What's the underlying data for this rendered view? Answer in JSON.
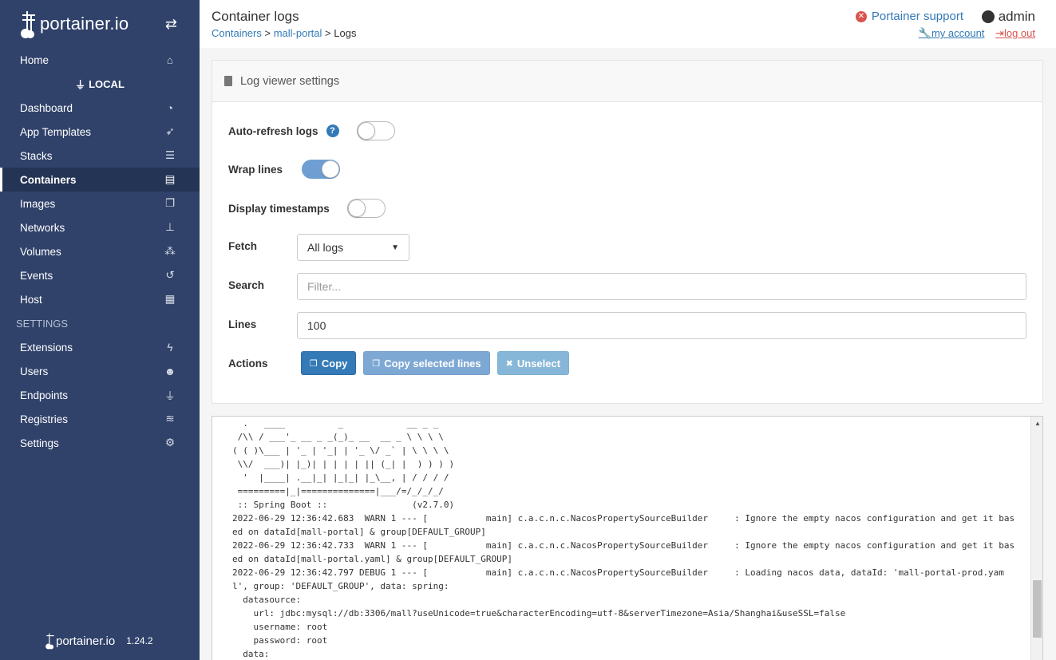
{
  "brand": {
    "name": "portainer.io",
    "version": "1.24.2"
  },
  "sidebar": {
    "items": [
      {
        "label": "Home",
        "icon": "home-icon"
      },
      {
        "label": "LOCAL",
        "icon": "plug-icon"
      },
      {
        "label": "Dashboard",
        "icon": "tachometer-icon"
      },
      {
        "label": "App Templates",
        "icon": "rocket-icon"
      },
      {
        "label": "Stacks",
        "icon": "list-icon"
      },
      {
        "label": "Containers",
        "icon": "server-icon"
      },
      {
        "label": "Images",
        "icon": "clone-icon"
      },
      {
        "label": "Networks",
        "icon": "sitemap-icon"
      },
      {
        "label": "Volumes",
        "icon": "cubes-icon"
      },
      {
        "label": "Events",
        "icon": "history-icon"
      },
      {
        "label": "Host",
        "icon": "th-icon"
      },
      {
        "label": "SETTINGS",
        "icon": ""
      },
      {
        "label": "Extensions",
        "icon": "bolt-icon"
      },
      {
        "label": "Users",
        "icon": "users-icon"
      },
      {
        "label": "Endpoints",
        "icon": "plug-icon"
      },
      {
        "label": "Registries",
        "icon": "database-icon"
      },
      {
        "label": "Settings",
        "icon": "cogs-icon"
      }
    ]
  },
  "header": {
    "title": "Container logs",
    "breadcrumb": {
      "containers": "Containers",
      "sep1": ">",
      "container": "mall-portal",
      "sep2": ">",
      "current": "Logs"
    },
    "support": "Portainer support",
    "user": "admin",
    "my_account": "my account",
    "log_out": "log out"
  },
  "settings": {
    "title": "Log viewer settings",
    "auto_refresh": {
      "label": "Auto-refresh logs",
      "on": false
    },
    "wrap_lines": {
      "label": "Wrap lines",
      "on": true
    },
    "timestamps": {
      "label": "Display timestamps",
      "on": false
    },
    "fetch": {
      "label": "Fetch",
      "value": "All logs"
    },
    "search": {
      "label": "Search",
      "placeholder": "Filter..."
    },
    "lines": {
      "label": "Lines",
      "value": "100"
    },
    "actions": {
      "label": "Actions",
      "copy": "Copy",
      "copy_selected": "Copy selected lines",
      "unselect": "Unselect"
    }
  },
  "logs": {
    "text": "  .   ____          _            __ _ _\n /\\\\ / ___'_ __ _ _(_)_ __  __ _ \\ \\ \\ \\\n( ( )\\___ | '_ | '_| | '_ \\/ _` | \\ \\ \\ \\\n \\\\/  ___)| |_)| | | | | || (_| |  ) ) ) )\n  '  |____| .__|_| |_|_| |_\\__, | / / / /\n =========|_|==============|___/=/_/_/_/\n :: Spring Boot ::                (v2.7.0)\n2022-06-29 12:36:42.683  WARN 1 --- [           main] c.a.c.n.c.NacosPropertySourceBuilder     : Ignore the empty nacos configuration and get it based on dataId[mall-portal] & group[DEFAULT_GROUP]\n2022-06-29 12:36:42.733  WARN 1 --- [           main] c.a.c.n.c.NacosPropertySourceBuilder     : Ignore the empty nacos configuration and get it based on dataId[mall-portal.yaml] & group[DEFAULT_GROUP]\n2022-06-29 12:36:42.797 DEBUG 1 --- [           main] c.a.c.n.c.NacosPropertySourceBuilder     : Loading nacos data, dataId: 'mall-portal-prod.yaml', group: 'DEFAULT_GROUP', data: spring:\n  datasource:\n    url: jdbc:mysql://db:3306/mall?useUnicode=true&characterEncoding=utf-8&serverTimezone=Asia/Shanghai&useSSL=false\n    username: root\n    password: root\n  data:"
  },
  "colors": {
    "sidebar": "#30426a",
    "primary": "#337ab7",
    "danger": "#d9534f"
  }
}
